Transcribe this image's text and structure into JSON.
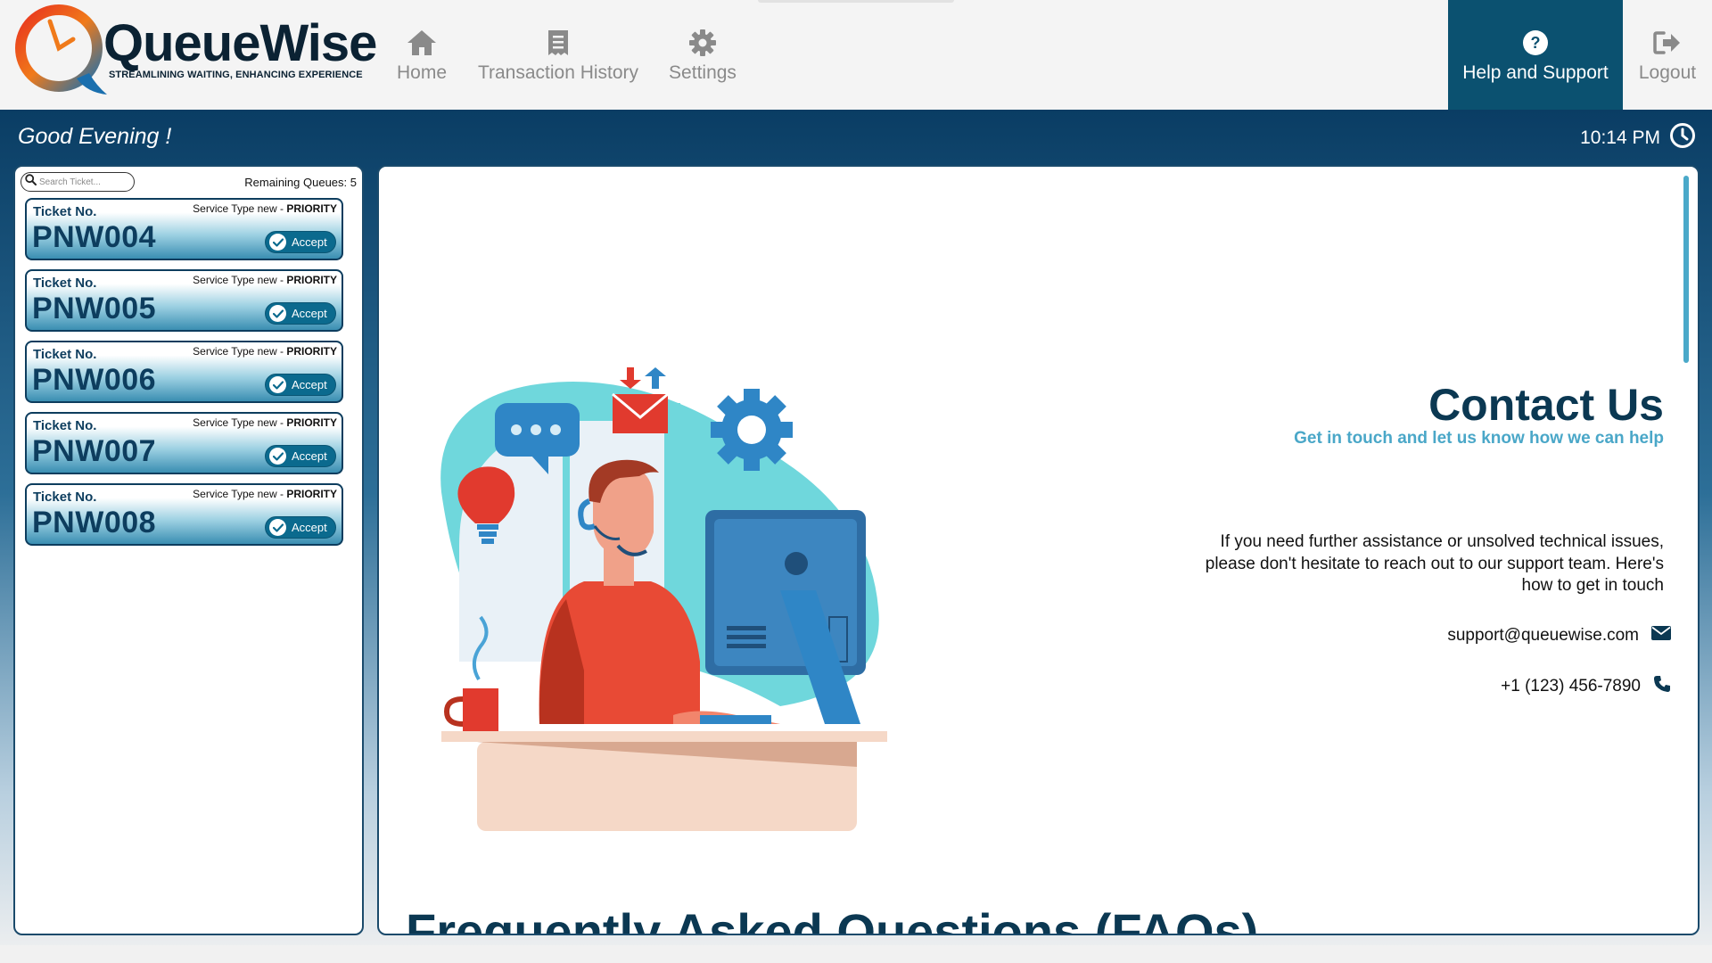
{
  "brand": {
    "name": "QueueWise",
    "tagline": "STREAMLINING WAITING, ENHANCING EXPERIENCE"
  },
  "nav": {
    "home": "Home",
    "history": "Transaction History",
    "settings": "Settings",
    "help": "Help and Support",
    "logout": "Logout"
  },
  "header": {
    "greeting": "Good Evening !",
    "time": "10:14 PM"
  },
  "queue": {
    "search_placeholder": "Search Ticket...",
    "remaining_label": "Remaining Queues: 5",
    "ticket_label": "Ticket No.",
    "service_prefix": "Service Type new - ",
    "service_priority": "PRIORITY",
    "accept_label": "Accept",
    "tickets": [
      "PNW004",
      "PNW005",
      "PNW006",
      "PNW007",
      "PNW008"
    ]
  },
  "contact": {
    "title": "Contact Us",
    "subtitle": "Get in touch and let us know how we can help",
    "description": "If you need further assistance or unsolved technical issues, please don't hesitate to reach out to our support team. Here's how to get in touch",
    "email": "support@queuewise.com",
    "phone": "+1 (123) 456-7890"
  },
  "faq": {
    "heading": "Frequently Asked Questions (FAQs)"
  },
  "colors": {
    "primary_dark": "#0b3852",
    "nav_active": "#0b5170",
    "accent": "#4aa7c8"
  }
}
